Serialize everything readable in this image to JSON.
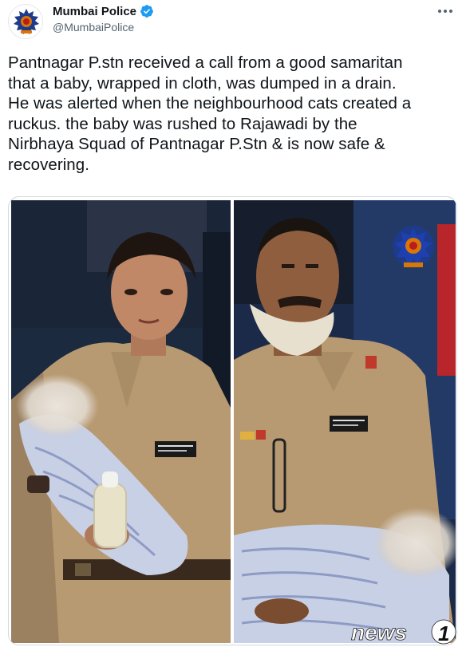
{
  "author": {
    "display_name": "Mumbai Police",
    "handle": "@MumbaiPolice",
    "verified": true,
    "avatar_icon": "mumbai-police-emblem-icon"
  },
  "more_icon": "more-horizontal-icon",
  "tweet": {
    "lines": [
      "Pantnagar P.stn received a call from a good samaritan",
      "that a baby, wrapped in cloth, was dumped in a drain.",
      "He was alerted when the neighbourhood cats created a",
      "ruckus. the baby was rushed to Rajawadi by the",
      "Nirbhaya Squad of Pantnagar P.Stn & is now safe &",
      "recovering."
    ]
  },
  "media": {
    "photos": [
      {
        "name": "policewoman-holding-baby-photo"
      },
      {
        "name": "policeman-holding-baby-photo"
      }
    ]
  },
  "watermark": {
    "text": "news1"
  },
  "colors": {
    "text": "#0f1419",
    "secondary": "#536471",
    "verified": "#1d9bf0",
    "khaki": "#b89a72",
    "border": "#cfd9de"
  }
}
